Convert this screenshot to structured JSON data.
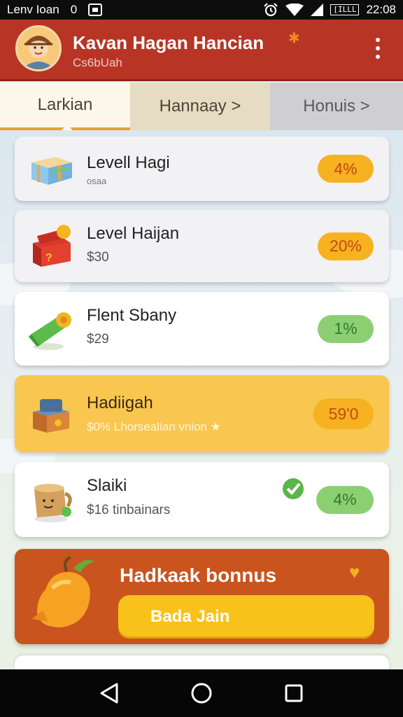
{
  "status_bar": {
    "carrier": "Lenv Ioan",
    "sim_label": "0",
    "time": "22:08",
    "battery_label": "[ILLL"
  },
  "header": {
    "title": "Kavan Hagan Hancian",
    "subtitle": "Cs6bUah"
  },
  "tabs": [
    {
      "label": "Larkian"
    },
    {
      "label": "Hannaay >"
    },
    {
      "label": "Honuis >"
    }
  ],
  "items": [
    {
      "title": "Levell Hagi",
      "subtitle": "osaa",
      "badge": "4%",
      "badge_color": "#f6b221",
      "icon": "blue-gift-box-icon"
    },
    {
      "title": "Level Haijan",
      "subtitle": "$30",
      "badge": "20%",
      "badge_color": "#f6b221",
      "icon": "red-treasure-chest-icon"
    },
    {
      "title": "Flent Sbany",
      "subtitle": "$29",
      "badge": "1%",
      "badge_color": "#8ccf73",
      "icon": "green-scroll-icon"
    },
    {
      "title": "Hadiigah",
      "subtitle": "$0% Lhorsealian vnion ★",
      "badge": "59'0",
      "badge_color": "#f6b221",
      "icon": "gold-chest-icon"
    },
    {
      "title": "Slaiki",
      "subtitle": "$16 tinbainars",
      "badge": "4%",
      "badge_color": "#8ccf73",
      "icon": "mug-character-icon"
    }
  ],
  "bonus": {
    "title": "Hadkaak bonnus",
    "button_label": "Bada Jain",
    "icon": "mango-fruit-icon"
  },
  "colors": {
    "header": "#b83526",
    "accent": "#e7a233",
    "highlight_card": "#f9c74f",
    "bonus_card": "#c9541d"
  }
}
